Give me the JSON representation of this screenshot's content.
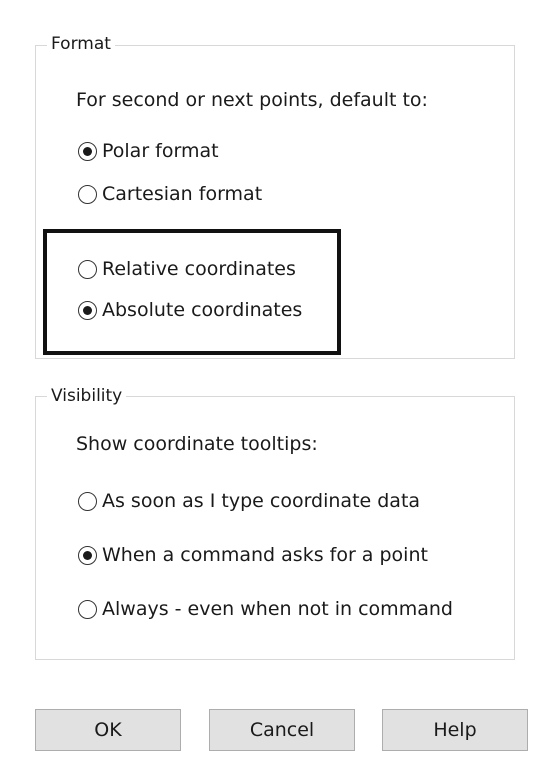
{
  "format": {
    "legend": "Format",
    "prompt": "For second or next points, default to:",
    "options": [
      {
        "label": "Polar format",
        "checked": true
      },
      {
        "label": "Cartesian format",
        "checked": false
      },
      {
        "label": "Relative coordinates",
        "checked": false
      },
      {
        "label": "Absolute coordinates",
        "checked": true
      }
    ]
  },
  "visibility": {
    "legend": "Visibility",
    "prompt": "Show coordinate tooltips:",
    "options": [
      {
        "label": "As soon as I type coordinate data",
        "checked": false
      },
      {
        "label": "When a command asks for a point",
        "checked": true
      },
      {
        "label": "Always - even when not in command",
        "checked": false
      }
    ]
  },
  "buttons": {
    "ok": "OK",
    "cancel": "Cancel",
    "help": "Help"
  }
}
